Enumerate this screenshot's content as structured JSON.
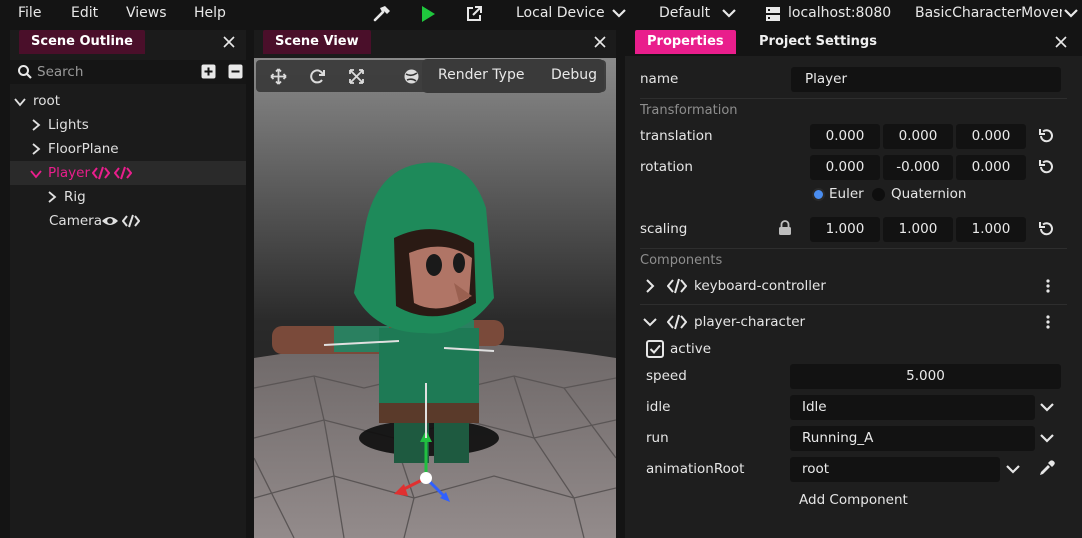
{
  "menu": {
    "file": "File",
    "edit": "Edit",
    "views": "Views",
    "help": "Help"
  },
  "toolbar": {
    "device": "Local Device",
    "profile": "Default",
    "server": "localhost:8080",
    "project": "BasicCharacterMovem"
  },
  "outline": {
    "tab": "Scene Outline",
    "search_placeholder": "Search",
    "items": [
      {
        "label": "root"
      },
      {
        "label": "Lights"
      },
      {
        "label": "FloorPlane"
      },
      {
        "label": "Player"
      },
      {
        "label": "Rig"
      },
      {
        "label": "Camera"
      }
    ]
  },
  "sceneview": {
    "tab": "Scene View",
    "render_type": "Render Type",
    "debug": "Debug"
  },
  "properties": {
    "tab_properties": "Properties",
    "tab_project_settings": "Project Settings",
    "name_label": "name",
    "name_value": "Player",
    "transformation_header": "Transformation",
    "translation_label": "translation",
    "translation": [
      "0.000",
      "0.000",
      "0.000"
    ],
    "rotation_label": "rotation",
    "rotation": [
      "0.000",
      "-0.000",
      "0.000"
    ],
    "euler": "Euler",
    "quaternion": "Quaternion",
    "scaling_label": "scaling",
    "scaling": [
      "1.000",
      "1.000",
      "1.000"
    ],
    "components_header": "Components",
    "components": [
      {
        "name": "keyboard-controller"
      },
      {
        "name": "player-character"
      }
    ],
    "active_label": "active",
    "speed_label": "speed",
    "speed_value": "5.000",
    "idle_label": "idle",
    "idle_value": "Idle",
    "run_label": "run",
    "run_value": "Running_A",
    "animation_root_label": "animationRoot",
    "animation_root_value": "root",
    "add_component": "Add Component"
  },
  "colors": {
    "accent": "#e91e8c",
    "tab_inactive_bg": "#4a0f2a",
    "play_green": "#1fc73d",
    "radio_selected": "#4a8df0"
  }
}
